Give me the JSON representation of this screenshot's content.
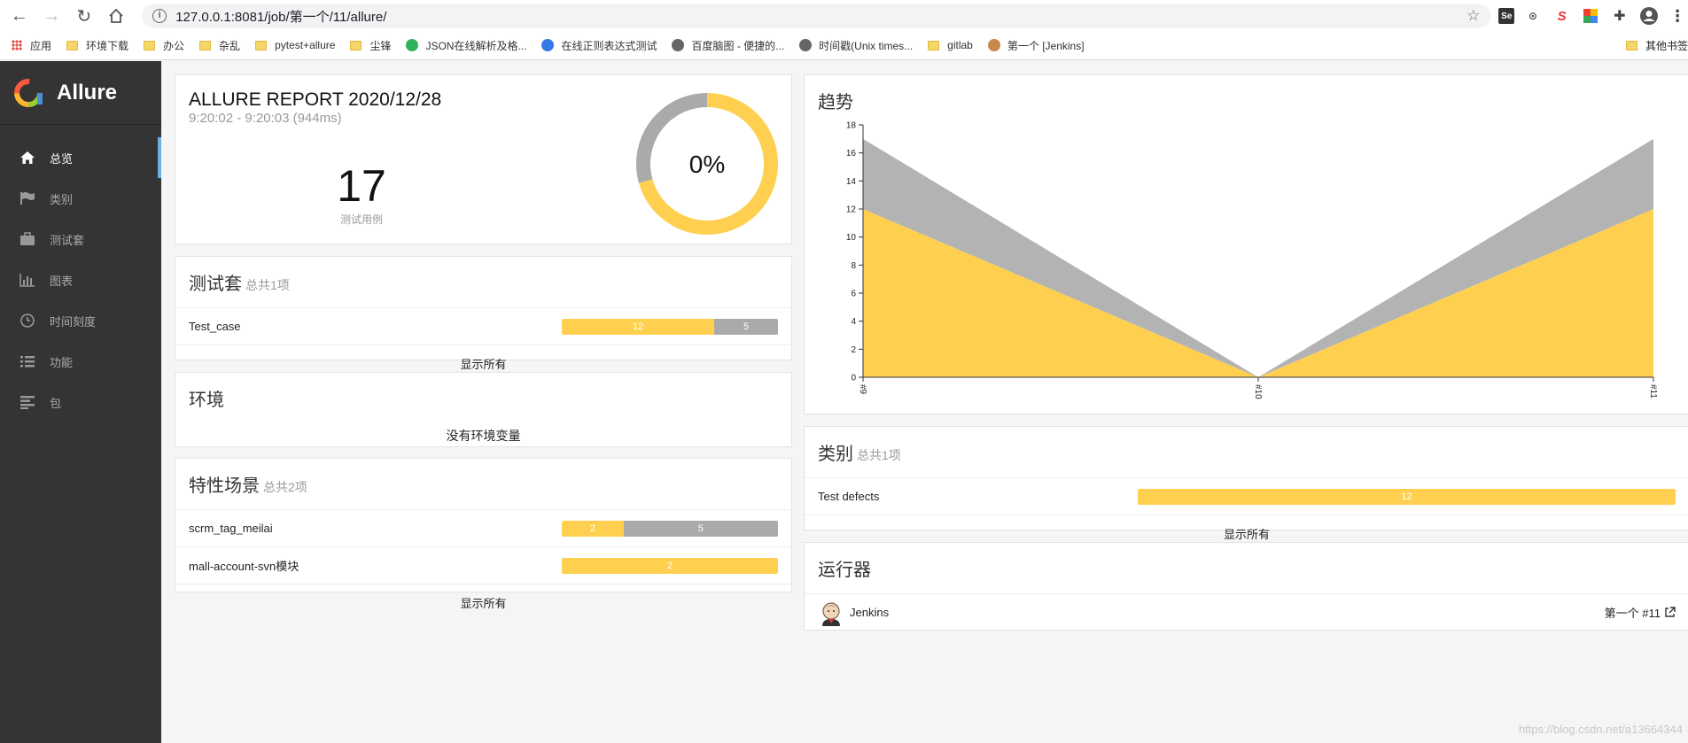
{
  "browser": {
    "url": "127.0.0.1:8081/job/第一个/11/allure/",
    "bookmarks": [
      {
        "label": "应用",
        "kind": "grid"
      },
      {
        "label": "环境下载",
        "kind": "folder"
      },
      {
        "label": "办公",
        "kind": "folder"
      },
      {
        "label": "杂乱",
        "kind": "folder"
      },
      {
        "label": "pytest+allure",
        "kind": "folder"
      },
      {
        "label": "尘锋",
        "kind": "folder"
      },
      {
        "label": "JSON在线解析及格...",
        "kind": "site",
        "color": "#2fb35b"
      },
      {
        "label": "在线正则表达式测试",
        "kind": "site",
        "color": "#3778e6"
      },
      {
        "label": "百度脑图 - 便捷的...",
        "kind": "site",
        "color": "#666666"
      },
      {
        "label": "时间戳(Unix times...",
        "kind": "site",
        "color": "#666666"
      },
      {
        "label": "gitlab",
        "kind": "folder"
      },
      {
        "label": "第一个 [Jenkins]",
        "kind": "site",
        "color": "#c9884e"
      }
    ],
    "other_bookmarks": "其他书签"
  },
  "sidebar": {
    "brand": "Allure",
    "items": [
      {
        "label": "总览",
        "icon": "home-icon",
        "active": true
      },
      {
        "label": "类别",
        "icon": "flag-icon",
        "active": false
      },
      {
        "label": "测试套",
        "icon": "briefcase-icon",
        "active": false
      },
      {
        "label": "图表",
        "icon": "bar-chart-icon",
        "active": false
      },
      {
        "label": "时间刻度",
        "icon": "clock-icon",
        "active": false
      },
      {
        "label": "功能",
        "icon": "list-icon",
        "active": false
      },
      {
        "label": "包",
        "icon": "align-left-icon",
        "active": false
      }
    ]
  },
  "summary": {
    "title": "ALLURE REPORT 2020/12/28",
    "time": "9:20:02 - 9:20:03 (944ms)",
    "count": "17",
    "count_label": "测试用例",
    "percent": "0%",
    "donut": {
      "failed": 12,
      "unknown": 5
    }
  },
  "suites": {
    "title": "测试套",
    "subtitle": "总共1项",
    "rows": [
      {
        "name": "Test_case",
        "segments": [
          {
            "value": 12,
            "color": "y"
          },
          {
            "value": 5,
            "color": "g"
          }
        ]
      }
    ],
    "show_all": "显示所有"
  },
  "environment": {
    "title": "环境",
    "empty": "没有环境变量"
  },
  "features": {
    "title": "特性场景",
    "subtitle": "总共2项",
    "rows": [
      {
        "name": "scrm_tag_meilai",
        "segments": [
          {
            "value": 2,
            "color": "y"
          },
          {
            "value": 5,
            "color": "g"
          }
        ]
      },
      {
        "name": "mall-account-svn模块",
        "segments": [
          {
            "value": 2,
            "color": "y"
          }
        ]
      }
    ],
    "show_all": "显示所有"
  },
  "trend": {
    "title": "趋势",
    "chart_data": {
      "type": "area",
      "categories": [
        "#9",
        "#10",
        "#11"
      ],
      "series": [
        {
          "values": [
            12,
            0,
            12
          ],
          "color": "#ffd050"
        },
        {
          "values": [
            5,
            0,
            5
          ],
          "color": "#b3b3b3"
        }
      ],
      "ylim": [
        0,
        18
      ],
      "yticks": [
        0,
        2,
        4,
        6,
        8,
        10,
        12,
        14,
        16,
        18
      ],
      "stacked": true
    }
  },
  "categories": {
    "title": "类别",
    "subtitle": "总共1项",
    "rows": [
      {
        "name": "Test defects",
        "segments": [
          {
            "value": 12,
            "color": "y"
          }
        ]
      }
    ],
    "show_all": "显示所有"
  },
  "executors": {
    "title": "运行器",
    "name": "Jenkins",
    "link": "第一个 #11"
  },
  "watermark": "https://blog.csdn.net/a13664344"
}
